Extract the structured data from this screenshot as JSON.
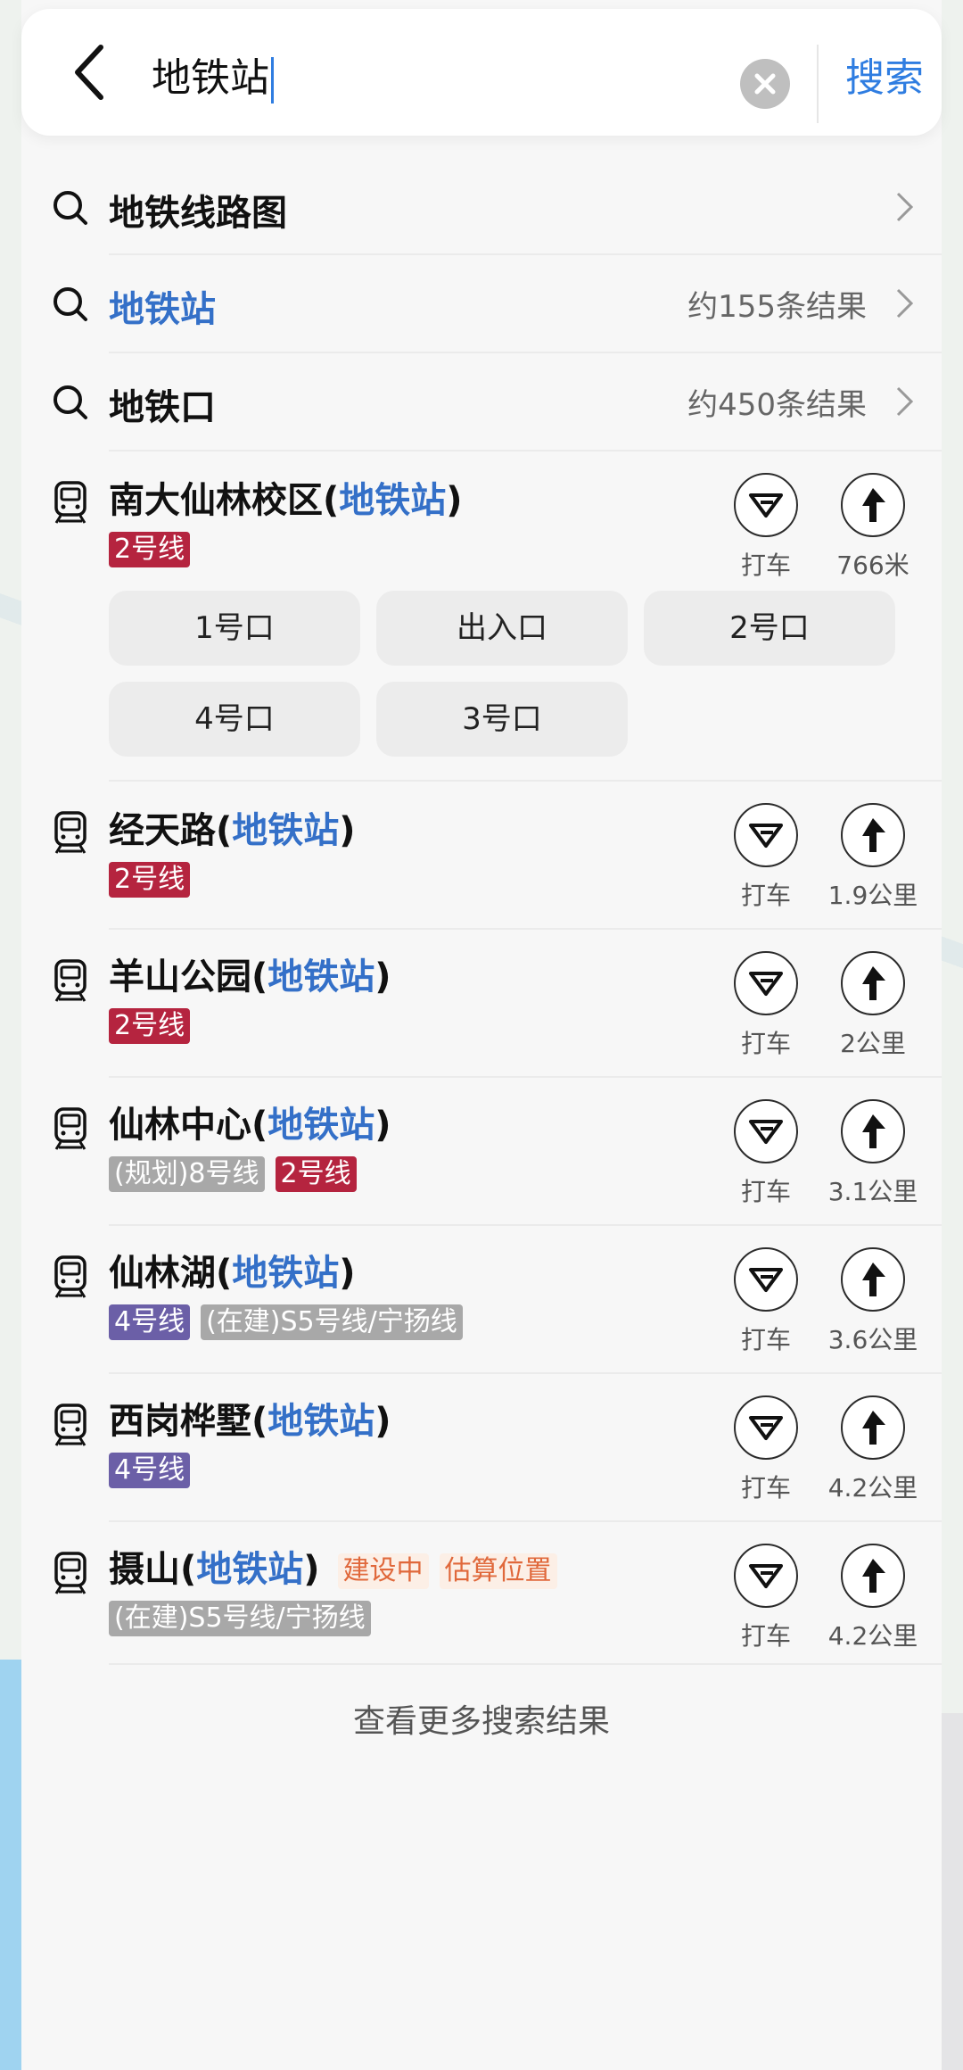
{
  "search": {
    "query": "地铁站",
    "submit_label": "搜索"
  },
  "suggestions": [
    {
      "title": "地铁线路图",
      "count": "",
      "highlight": false
    },
    {
      "title": "地铁站",
      "count": "约155条结果",
      "highlight": true
    },
    {
      "title": "地铁口",
      "count": "约450条结果",
      "highlight": false
    }
  ],
  "stations": [
    {
      "name": "南大仙林校区",
      "keyword": "地铁站",
      "tags": [
        {
          "text": "2号线",
          "color": "red"
        }
      ],
      "taxi_label": "打车",
      "distance": "766米",
      "exits": [
        "1号口",
        "出入口",
        "2号口",
        "4号口",
        "3号口"
      ]
    },
    {
      "name": "经天路",
      "keyword": "地铁站",
      "tags": [
        {
          "text": "2号线",
          "color": "red"
        }
      ],
      "taxi_label": "打车",
      "distance": "1.9公里"
    },
    {
      "name": "羊山公园",
      "keyword": "地铁站",
      "tags": [
        {
          "text": "2号线",
          "color": "red"
        }
      ],
      "taxi_label": "打车",
      "distance": "2公里"
    },
    {
      "name": "仙林中心",
      "keyword": "地铁站",
      "tags": [
        {
          "text": "(规划)8号线",
          "color": "gray"
        },
        {
          "text": "2号线",
          "color": "red"
        }
      ],
      "taxi_label": "打车",
      "distance": "3.1公里"
    },
    {
      "name": "仙林湖",
      "keyword": "地铁站",
      "tags": [
        {
          "text": "4号线",
          "color": "purple"
        },
        {
          "text": "(在建)S5号线/宁扬线",
          "color": "gray"
        }
      ],
      "taxi_label": "打车",
      "distance": "3.6公里"
    },
    {
      "name": "西岗桦墅",
      "keyword": "地铁站",
      "tags": [
        {
          "text": "4号线",
          "color": "purple"
        }
      ],
      "taxi_label": "打车",
      "distance": "4.2公里"
    },
    {
      "name": "摄山",
      "keyword": "地铁站",
      "status_tags": [
        "建设中",
        "估算位置"
      ],
      "tags": [
        {
          "text": "(在建)S5号线/宁扬线",
          "color": "gray"
        }
      ],
      "taxi_label": "打车",
      "distance": "4.2公里"
    }
  ],
  "footer": {
    "more_label": "查看更多搜索结果"
  },
  "colors": {
    "accent": "#3470c8",
    "line2": "#b5243f",
    "line4": "#6b5fa7"
  }
}
